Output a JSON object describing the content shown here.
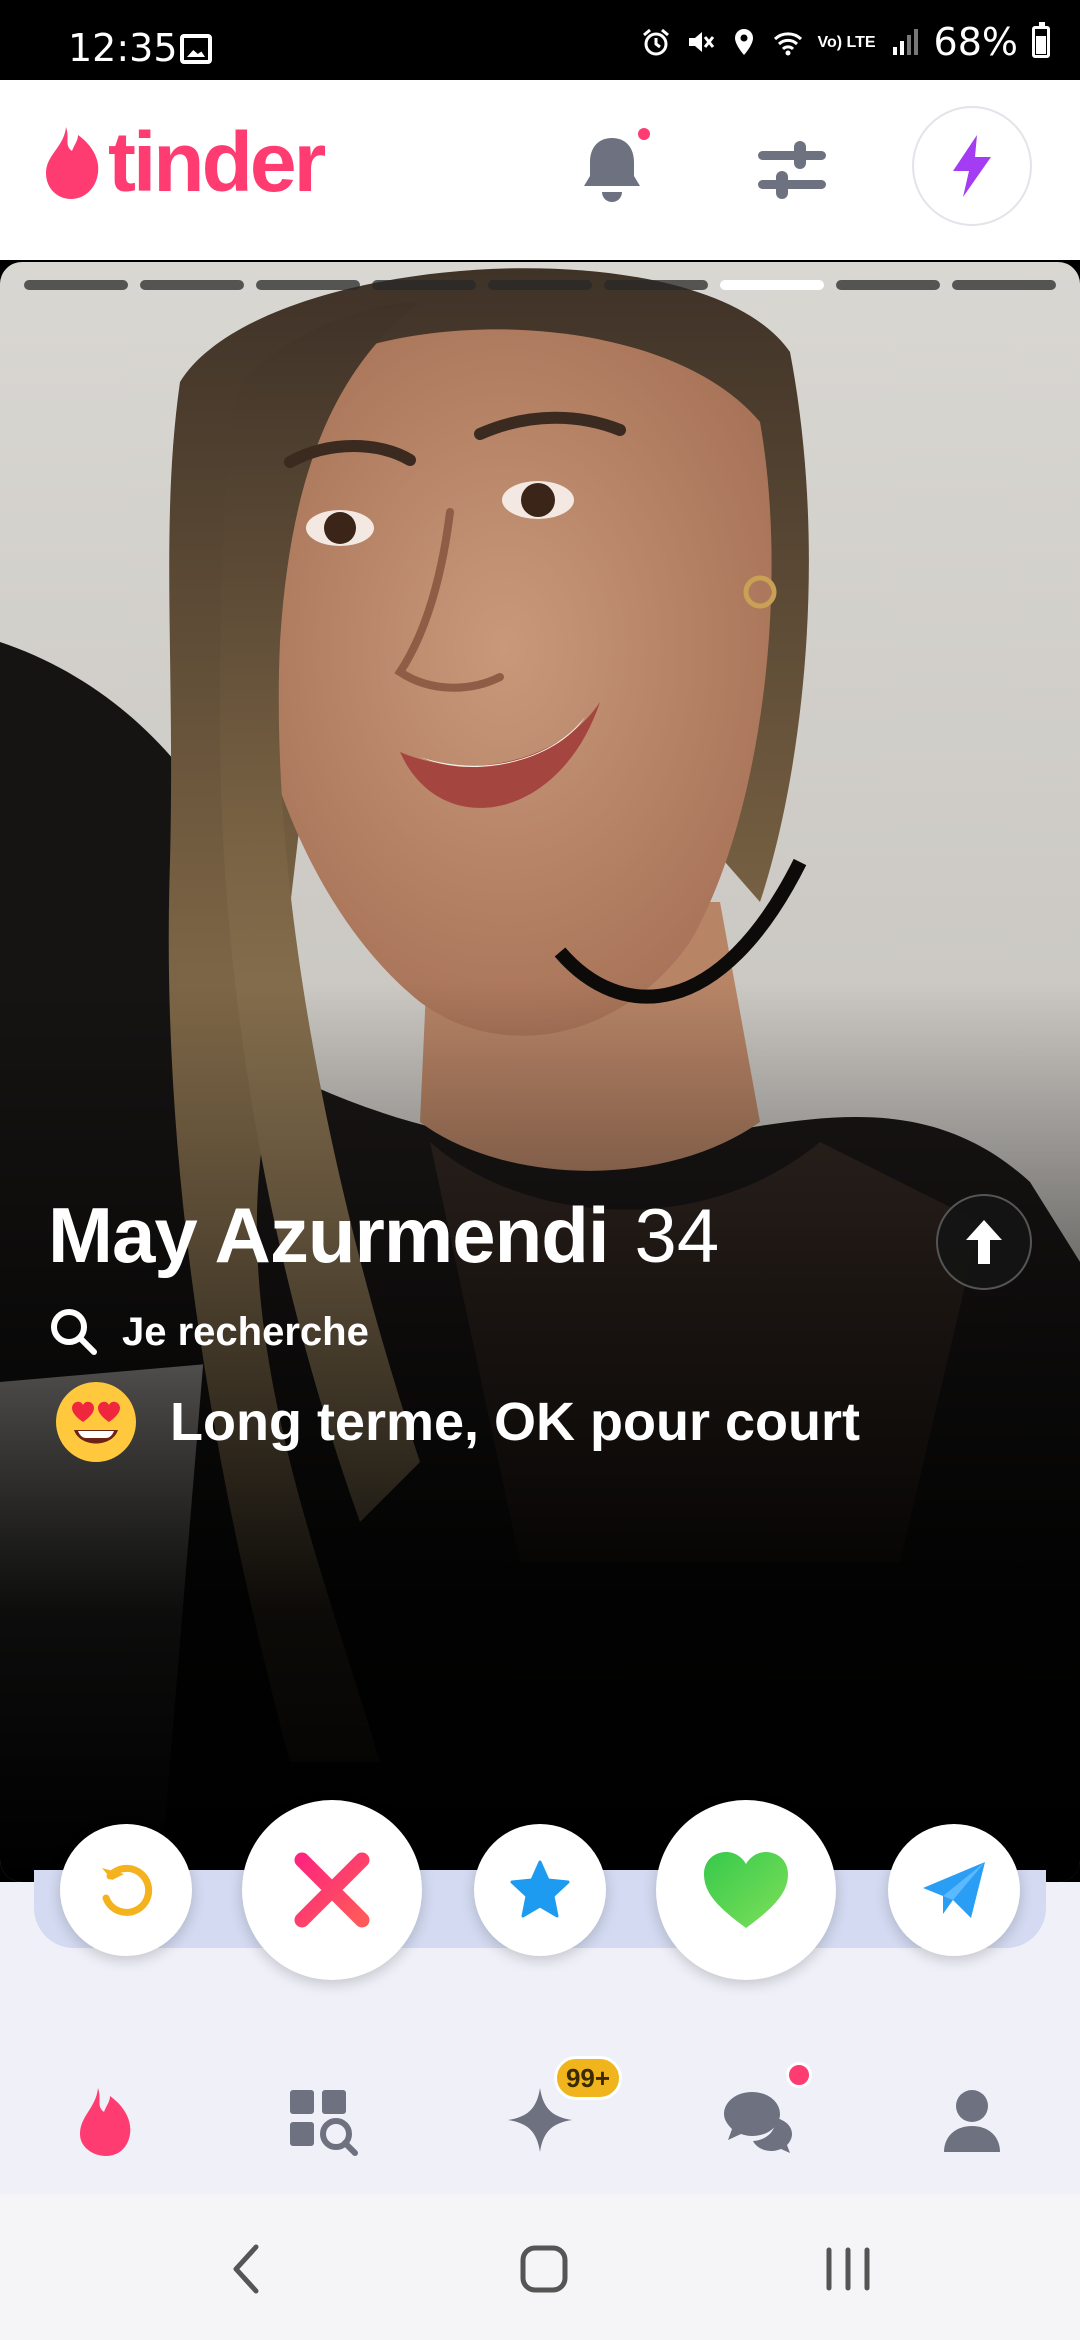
{
  "status_bar": {
    "time": "12:35",
    "network": "Vo) LTE",
    "battery": "68%"
  },
  "header": {
    "logo_text": "tinder",
    "brand_color": "#fe3c72",
    "boost_color": "#a33cf2"
  },
  "card": {
    "photo_count": 9,
    "active_photo_index": 6,
    "name": "May Azurmendi",
    "age": "34",
    "looking_for_label": "Je recherche",
    "relationship_goal": "Long terme, OK pour court",
    "goal_emoji": "heart-eyes-emoji"
  },
  "actions": {
    "rewind_color": "#f4b21c",
    "nope_color": "#fe3c72",
    "superlike_color": "#1d9bf0",
    "like_color": "#4fd24c",
    "send_color": "#2a9df4"
  },
  "bottom_nav": {
    "gold_badge": "99+",
    "active_tab": "home"
  }
}
